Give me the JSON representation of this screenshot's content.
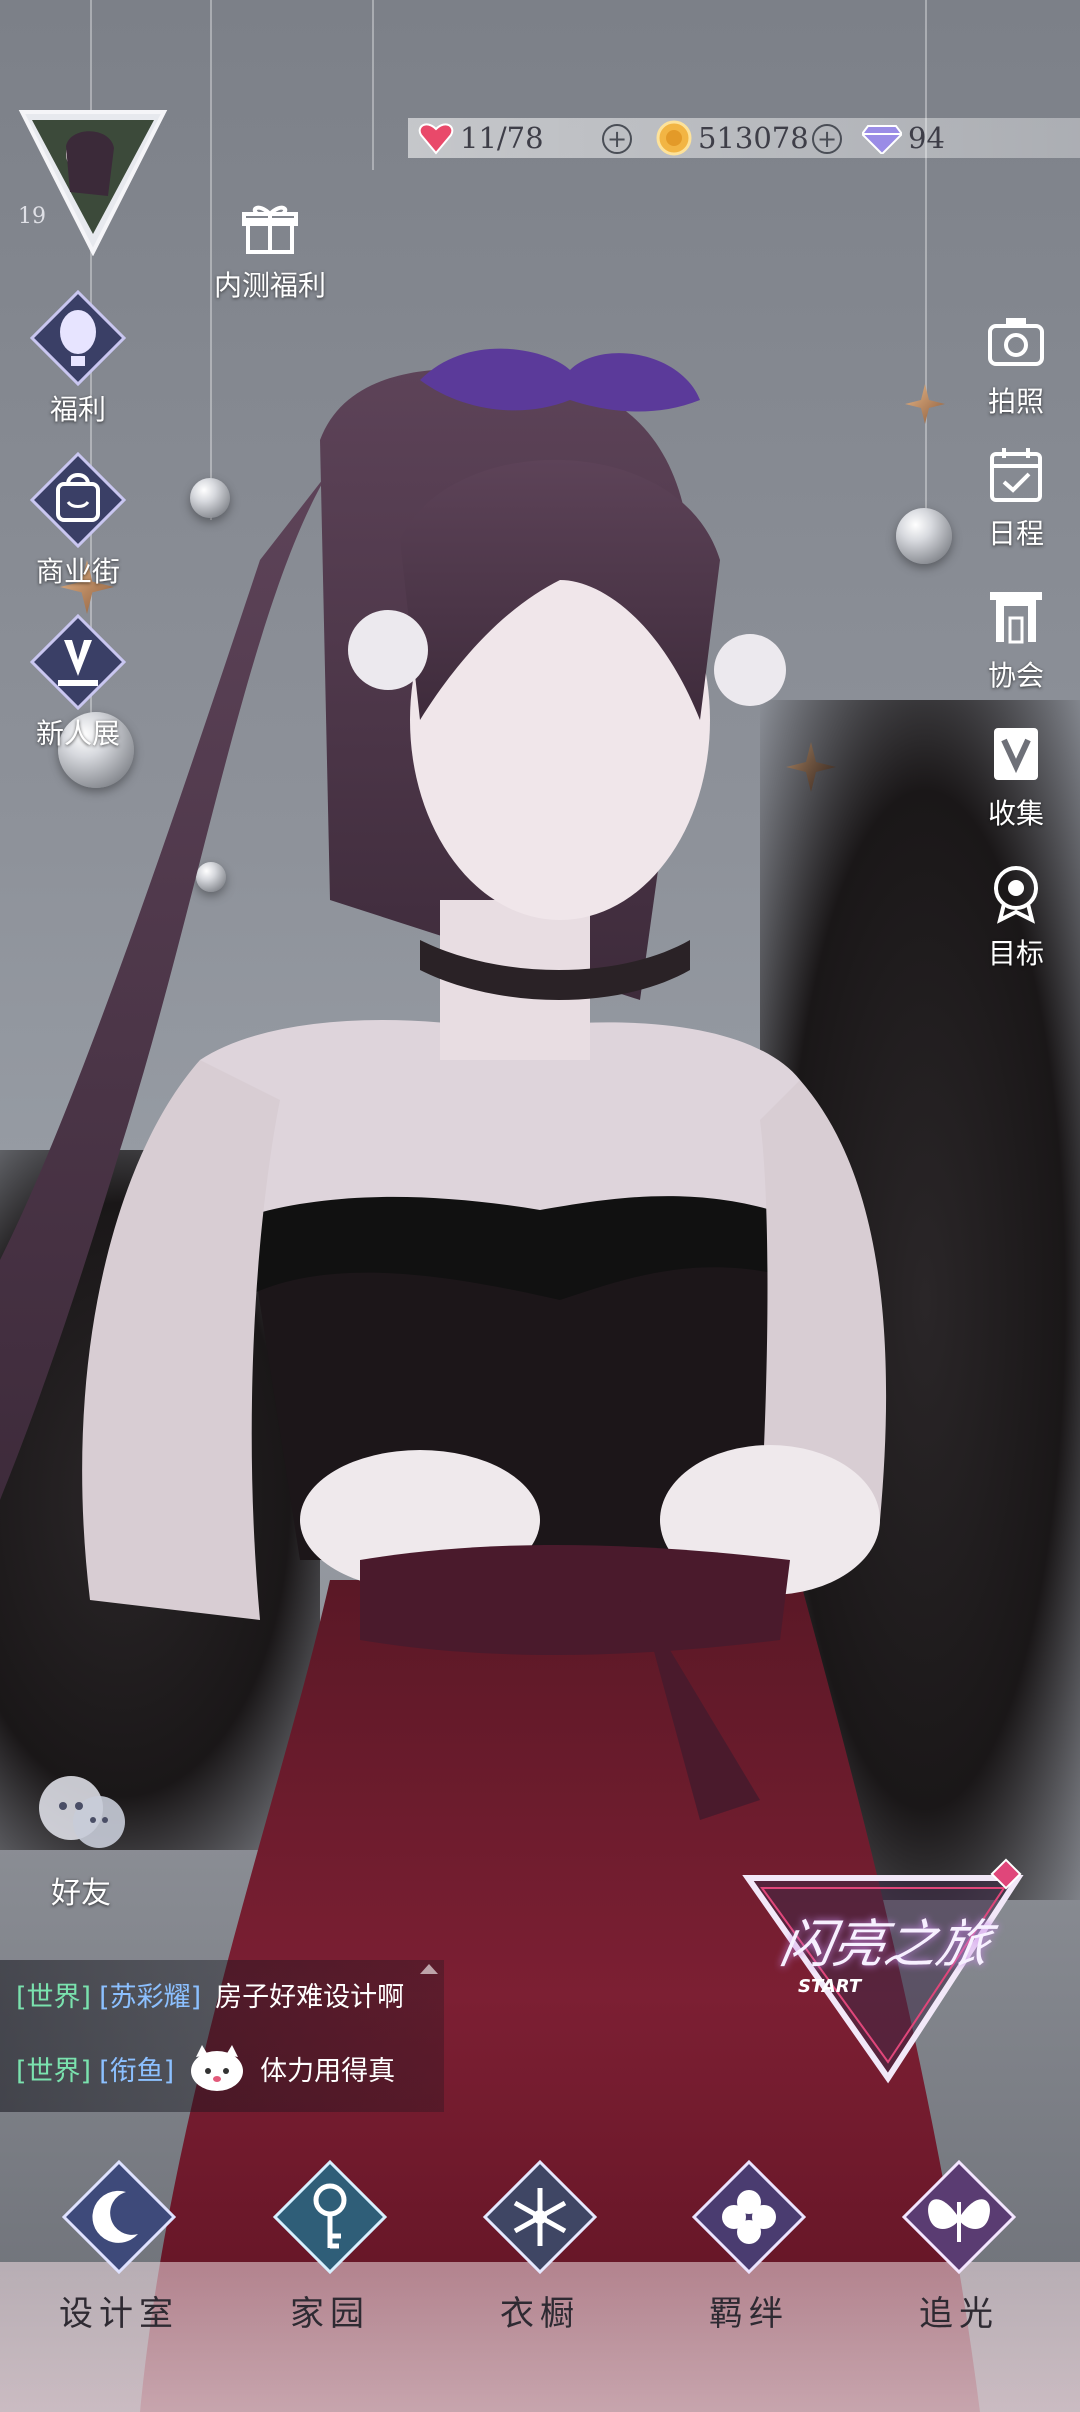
{
  "resources": {
    "stamina": {
      "value": "11/78",
      "icon": "heart-gem-icon"
    },
    "gold": {
      "value": "513078",
      "icon": "gold-coin-icon"
    },
    "diamond": {
      "value": "94",
      "icon": "diamond-icon"
    }
  },
  "player": {
    "level": "19"
  },
  "beta_gift": {
    "label": "内测福利"
  },
  "left_menu": [
    {
      "label": "福利",
      "icon": "hot-air-balloon-icon"
    },
    {
      "label": "商业街",
      "icon": "shopping-bag-icon"
    },
    {
      "label": "新人展",
      "icon": "newcomer-exhibit-icon"
    }
  ],
  "right_menu": [
    {
      "label": "拍照",
      "icon": "camera-icon"
    },
    {
      "label": "日程",
      "icon": "calendar-check-icon"
    },
    {
      "label": "协会",
      "icon": "association-gate-icon"
    },
    {
      "label": "收集",
      "icon": "collection-book-icon"
    },
    {
      "label": "目标",
      "icon": "target-badge-icon"
    }
  ],
  "friends": {
    "label": "好友"
  },
  "chat": [
    {
      "channel": "[世界]",
      "user": "[苏彩耀]",
      "message": "房子好难设计啊"
    },
    {
      "channel": "[世界]",
      "user": "[衔鱼]",
      "message": "体力用得真"
    }
  ],
  "journey": {
    "title": "闪亮之旅",
    "subtitle": "START"
  },
  "bottom_nav": [
    {
      "label": "设计室",
      "icon": "moon-crest-icon"
    },
    {
      "label": "家园",
      "icon": "key-crest-icon"
    },
    {
      "label": "衣橱",
      "icon": "snowflake-crest-icon"
    },
    {
      "label": "羁绊",
      "icon": "clover-crest-icon"
    },
    {
      "label": "追光",
      "icon": "butterfly-crest-icon"
    }
  ],
  "colors": {
    "chat_channel": "#7ae2ae",
    "chat_user": "#8cc0ff",
    "journey_accent": "#e0467a"
  }
}
